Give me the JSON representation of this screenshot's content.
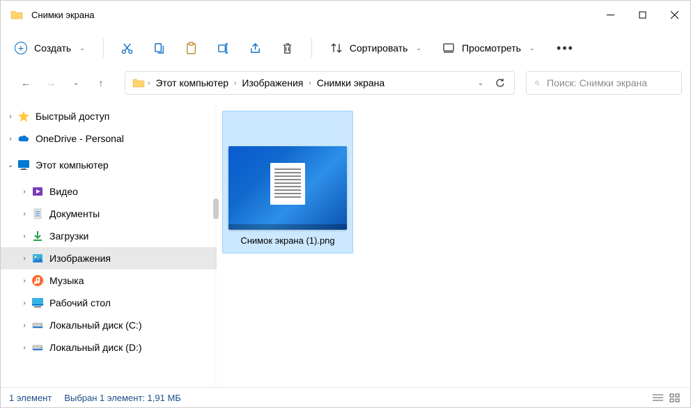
{
  "title": "Снимки экрана",
  "toolbar": {
    "create": "Создать",
    "sort": "Сортировать",
    "view": "Просмотреть"
  },
  "breadcrumbs": [
    "Этот компьютер",
    "Изображения",
    "Снимки экрана"
  ],
  "search": {
    "placeholder": "Поиск: Снимки экрана"
  },
  "sidebar": [
    {
      "label": "Быстрый доступ",
      "icon": "star",
      "indent": 0,
      "expandable": true,
      "arrow": "right"
    },
    {
      "label": "OneDrive - Personal",
      "icon": "onedrive",
      "indent": 0,
      "expandable": true,
      "arrow": "right"
    },
    {
      "label": "Этот компьютер",
      "icon": "monitor",
      "indent": 0,
      "expandable": true,
      "arrow": "down"
    },
    {
      "label": "Видео",
      "icon": "video",
      "indent": 1,
      "expandable": true,
      "arrow": "right"
    },
    {
      "label": "Документы",
      "icon": "doc",
      "indent": 1,
      "expandable": true,
      "arrow": "right"
    },
    {
      "label": "Загрузки",
      "icon": "download",
      "indent": 1,
      "expandable": true,
      "arrow": "right"
    },
    {
      "label": "Изображения",
      "icon": "picture",
      "indent": 1,
      "expandable": true,
      "arrow": "right",
      "selected": true
    },
    {
      "label": "Музыка",
      "icon": "music",
      "indent": 1,
      "expandable": true,
      "arrow": "right"
    },
    {
      "label": "Рабочий стол",
      "icon": "desktop",
      "indent": 1,
      "expandable": true,
      "arrow": "right"
    },
    {
      "label": "Локальный диск (C:)",
      "icon": "disk",
      "indent": 1,
      "expandable": true,
      "arrow": "right"
    },
    {
      "label": "Локальный диск (D:)",
      "icon": "disk",
      "indent": 1,
      "expandable": true,
      "arrow": "right"
    }
  ],
  "file": {
    "name": "Снимок экрана (1).png"
  },
  "status": {
    "count": "1 элемент",
    "selection": "Выбран 1 элемент: 1,91 МБ"
  }
}
